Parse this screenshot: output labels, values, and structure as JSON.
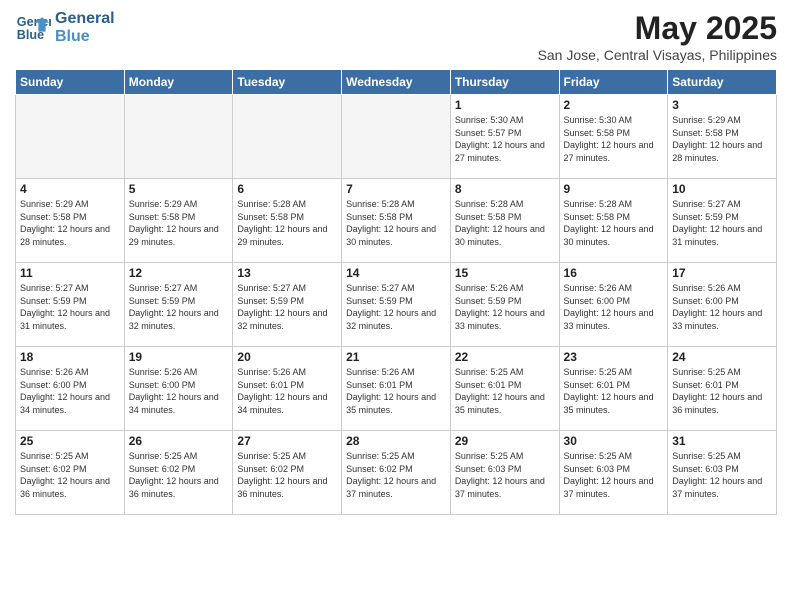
{
  "logo": {
    "line1": "General",
    "line2": "Blue"
  },
  "title": "May 2025",
  "subtitle": "San Jose, Central Visayas, Philippines",
  "days_of_week": [
    "Sunday",
    "Monday",
    "Tuesday",
    "Wednesday",
    "Thursday",
    "Friday",
    "Saturday"
  ],
  "weeks": [
    [
      {
        "day": "",
        "info": ""
      },
      {
        "day": "",
        "info": ""
      },
      {
        "day": "",
        "info": ""
      },
      {
        "day": "",
        "info": ""
      },
      {
        "day": "1",
        "info": "Sunrise: 5:30 AM\nSunset: 5:57 PM\nDaylight: 12 hours\nand 27 minutes."
      },
      {
        "day": "2",
        "info": "Sunrise: 5:30 AM\nSunset: 5:58 PM\nDaylight: 12 hours\nand 27 minutes."
      },
      {
        "day": "3",
        "info": "Sunrise: 5:29 AM\nSunset: 5:58 PM\nDaylight: 12 hours\nand 28 minutes."
      }
    ],
    [
      {
        "day": "4",
        "info": "Sunrise: 5:29 AM\nSunset: 5:58 PM\nDaylight: 12 hours\nand 28 minutes."
      },
      {
        "day": "5",
        "info": "Sunrise: 5:29 AM\nSunset: 5:58 PM\nDaylight: 12 hours\nand 29 minutes."
      },
      {
        "day": "6",
        "info": "Sunrise: 5:28 AM\nSunset: 5:58 PM\nDaylight: 12 hours\nand 29 minutes."
      },
      {
        "day": "7",
        "info": "Sunrise: 5:28 AM\nSunset: 5:58 PM\nDaylight: 12 hours\nand 30 minutes."
      },
      {
        "day": "8",
        "info": "Sunrise: 5:28 AM\nSunset: 5:58 PM\nDaylight: 12 hours\nand 30 minutes."
      },
      {
        "day": "9",
        "info": "Sunrise: 5:28 AM\nSunset: 5:58 PM\nDaylight: 12 hours\nand 30 minutes."
      },
      {
        "day": "10",
        "info": "Sunrise: 5:27 AM\nSunset: 5:59 PM\nDaylight: 12 hours\nand 31 minutes."
      }
    ],
    [
      {
        "day": "11",
        "info": "Sunrise: 5:27 AM\nSunset: 5:59 PM\nDaylight: 12 hours\nand 31 minutes."
      },
      {
        "day": "12",
        "info": "Sunrise: 5:27 AM\nSunset: 5:59 PM\nDaylight: 12 hours\nand 32 minutes."
      },
      {
        "day": "13",
        "info": "Sunrise: 5:27 AM\nSunset: 5:59 PM\nDaylight: 12 hours\nand 32 minutes."
      },
      {
        "day": "14",
        "info": "Sunrise: 5:27 AM\nSunset: 5:59 PM\nDaylight: 12 hours\nand 32 minutes."
      },
      {
        "day": "15",
        "info": "Sunrise: 5:26 AM\nSunset: 5:59 PM\nDaylight: 12 hours\nand 33 minutes."
      },
      {
        "day": "16",
        "info": "Sunrise: 5:26 AM\nSunset: 6:00 PM\nDaylight: 12 hours\nand 33 minutes."
      },
      {
        "day": "17",
        "info": "Sunrise: 5:26 AM\nSunset: 6:00 PM\nDaylight: 12 hours\nand 33 minutes."
      }
    ],
    [
      {
        "day": "18",
        "info": "Sunrise: 5:26 AM\nSunset: 6:00 PM\nDaylight: 12 hours\nand 34 minutes."
      },
      {
        "day": "19",
        "info": "Sunrise: 5:26 AM\nSunset: 6:00 PM\nDaylight: 12 hours\nand 34 minutes."
      },
      {
        "day": "20",
        "info": "Sunrise: 5:26 AM\nSunset: 6:01 PM\nDaylight: 12 hours\nand 34 minutes."
      },
      {
        "day": "21",
        "info": "Sunrise: 5:26 AM\nSunset: 6:01 PM\nDaylight: 12 hours\nand 35 minutes."
      },
      {
        "day": "22",
        "info": "Sunrise: 5:25 AM\nSunset: 6:01 PM\nDaylight: 12 hours\nand 35 minutes."
      },
      {
        "day": "23",
        "info": "Sunrise: 5:25 AM\nSunset: 6:01 PM\nDaylight: 12 hours\nand 35 minutes."
      },
      {
        "day": "24",
        "info": "Sunrise: 5:25 AM\nSunset: 6:01 PM\nDaylight: 12 hours\nand 36 minutes."
      }
    ],
    [
      {
        "day": "25",
        "info": "Sunrise: 5:25 AM\nSunset: 6:02 PM\nDaylight: 12 hours\nand 36 minutes."
      },
      {
        "day": "26",
        "info": "Sunrise: 5:25 AM\nSunset: 6:02 PM\nDaylight: 12 hours\nand 36 minutes."
      },
      {
        "day": "27",
        "info": "Sunrise: 5:25 AM\nSunset: 6:02 PM\nDaylight: 12 hours\nand 36 minutes."
      },
      {
        "day": "28",
        "info": "Sunrise: 5:25 AM\nSunset: 6:02 PM\nDaylight: 12 hours\nand 37 minutes."
      },
      {
        "day": "29",
        "info": "Sunrise: 5:25 AM\nSunset: 6:03 PM\nDaylight: 12 hours\nand 37 minutes."
      },
      {
        "day": "30",
        "info": "Sunrise: 5:25 AM\nSunset: 6:03 PM\nDaylight: 12 hours\nand 37 minutes."
      },
      {
        "day": "31",
        "info": "Sunrise: 5:25 AM\nSunset: 6:03 PM\nDaylight: 12 hours\nand 37 minutes."
      }
    ]
  ]
}
